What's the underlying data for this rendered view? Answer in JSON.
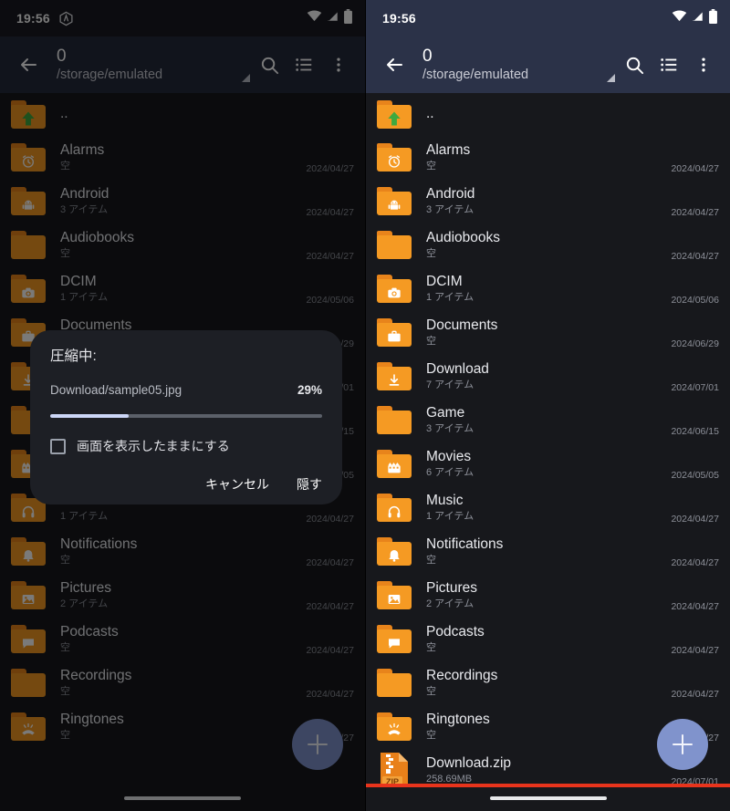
{
  "colors": {
    "toolbar": "#2b3248",
    "list_bg": "#17181c",
    "folder": "#f59a23",
    "fab": "#8093cc",
    "progress_fill": "#ccd6f7",
    "red_line": "#e8341c"
  },
  "status_bar": {
    "time": "19:56",
    "app_icon": "hexagon-app-icon",
    "wifi_icon": "wifi-icon",
    "signal_icon": "signal-no-service-icon",
    "battery_icon": "battery-icon"
  },
  "toolbar": {
    "back_icon": "back-arrow-icon",
    "title": "0",
    "subtitle": "/storage/emulated",
    "resize_corner_icon": "resize-corner-icon",
    "search_icon": "search-icon",
    "list_view_icon": "list-view-icon",
    "overflow_icon": "more-vertical-icon"
  },
  "fab": {
    "label": "+",
    "icon": "plus-icon"
  },
  "files": [
    {
      "name": "..",
      "sub": "",
      "date": "",
      "icon": "folder-up-icon",
      "type": "folder"
    },
    {
      "name": "Alarms",
      "sub": "空",
      "date": "2024/04/27",
      "icon": "folder-alarm-icon",
      "type": "folder"
    },
    {
      "name": "Android",
      "sub": "3 アイテム",
      "date": "2024/04/27",
      "icon": "folder-android-icon",
      "type": "folder"
    },
    {
      "name": "Audiobooks",
      "sub": "空",
      "date": "2024/04/27",
      "icon": "folder-plain-icon",
      "type": "folder"
    },
    {
      "name": "DCIM",
      "sub": "1 アイテム",
      "date": "2024/05/06",
      "icon": "folder-camera-icon",
      "type": "folder"
    },
    {
      "name": "Documents",
      "sub": "空",
      "date": "2024/06/29",
      "icon": "folder-briefcase-icon",
      "type": "folder"
    },
    {
      "name": "Download",
      "sub": "7 アイテム",
      "date": "2024/07/01",
      "icon": "folder-download-icon",
      "type": "folder"
    },
    {
      "name": "Game",
      "sub": "3 アイテム",
      "date": "2024/06/15",
      "icon": "folder-plain-icon",
      "type": "folder"
    },
    {
      "name": "Movies",
      "sub": "6 アイテム",
      "date": "2024/05/05",
      "icon": "folder-movie-icon",
      "type": "folder"
    },
    {
      "name": "Music",
      "sub": "1 アイテム",
      "date": "2024/04/27",
      "icon": "folder-music-icon",
      "type": "folder"
    },
    {
      "name": "Notifications",
      "sub": "空",
      "date": "2024/04/27",
      "icon": "folder-bell-icon",
      "type": "folder"
    },
    {
      "name": "Pictures",
      "sub": "2 アイテム",
      "date": "2024/04/27",
      "icon": "folder-image-icon",
      "type": "folder"
    },
    {
      "name": "Podcasts",
      "sub": "空",
      "date": "2024/04/27",
      "icon": "folder-chat-icon",
      "type": "folder"
    },
    {
      "name": "Recordings",
      "sub": "空",
      "date": "2024/04/27",
      "icon": "folder-plain-icon",
      "type": "folder"
    },
    {
      "name": "Ringtones",
      "sub": "空",
      "date": "2024/04/27",
      "icon": "folder-ringtone-icon",
      "type": "folder"
    },
    {
      "name": "Download.zip",
      "sub": "258.69MB",
      "date": "2024/07/01",
      "icon": "zip-file-icon",
      "type": "file"
    }
  ],
  "dialog": {
    "title": "圧縮中:",
    "file": "Download/sample05.jpg",
    "percent_label": "29%",
    "percent_value": 29,
    "checkbox_label": "画面を表示したままにする",
    "checkbox_checked": false,
    "cancel_label": "キャンセル",
    "hide_label": "隠す"
  }
}
